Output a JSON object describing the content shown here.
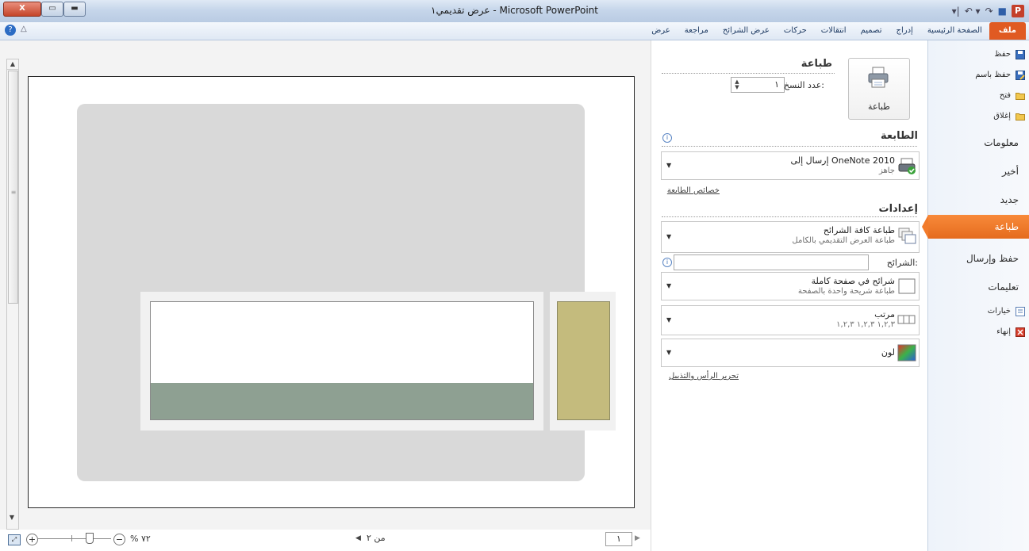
{
  "window": {
    "title": "عرض تقديمي١  -  Microsoft PowerPoint",
    "close_label": "X"
  },
  "ribbon": {
    "tabs": [
      "ملف",
      "الصفحة الرئيسية",
      "إدراج",
      "تصميم",
      "انتقالات",
      "حركات",
      "عرض الشرائح",
      "مراجعة",
      "عرض"
    ]
  },
  "file_menu": {
    "save": "حفظ",
    "save_as": "حفظ باسم",
    "open": "فتح",
    "close": "إغلاق",
    "info": "معلومات",
    "recent": "أخير",
    "new": "جديد",
    "print": "طباعة",
    "save_send": "حفظ وإرسال",
    "help": "تعليمات",
    "options": "خيارات",
    "exit": "إنهاء"
  },
  "print_panel": {
    "section_title": "طباعة",
    "print_button": "طباعة",
    "copies_label": "عدد النسخ:",
    "copies_value": "١",
    "printer_title": "الطابعة",
    "printer_name": "إرسال إلى OneNote 2010",
    "printer_status": "جاهز",
    "printer_properties": "خصائص الطابعة",
    "settings_title": "إعدادات",
    "slides_option_title": "طباعة كافة الشرائح",
    "slides_option_sub": "طباعة العرض التقديمي بالكامل",
    "slides_label": "الشرائح:",
    "slides_value": "",
    "layout_title": "شرائح في صفحة كاملة",
    "layout_sub": "طباعة شريحة واحدة بالصفحة",
    "collate_title": "مرتب",
    "collate_sub": "١,٢,٣   ١,٢,٣   ١,٢,٣",
    "color_title": "لون",
    "header_footer": "تحرير الرأس والتذييل"
  },
  "status_bar": {
    "zoom": "% ٧٢",
    "page_of": "من ٢",
    "page_current": "١"
  },
  "colors": {
    "accent": "#e56b1e",
    "file_tab": "#e05a22",
    "band_green": "#8ea092",
    "khaki": "#c4bb7d"
  }
}
